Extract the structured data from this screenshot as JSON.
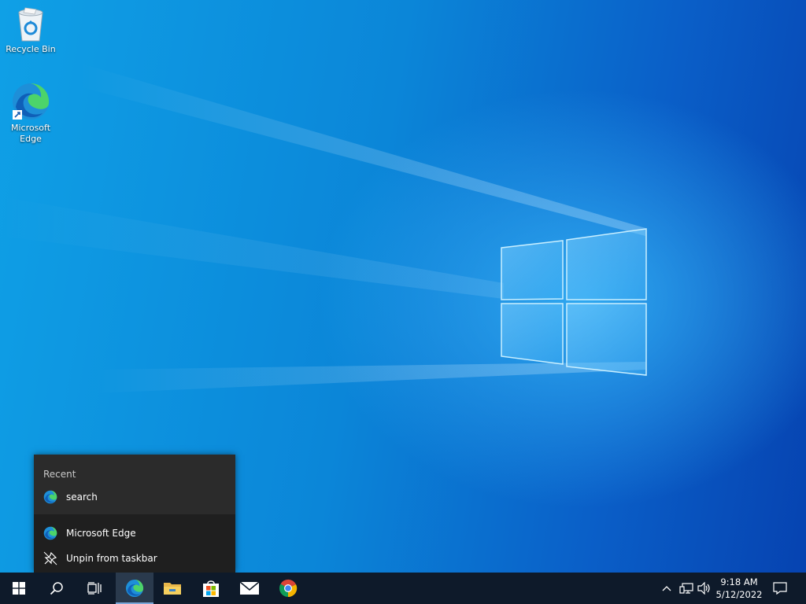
{
  "desktop": {
    "icons": [
      {
        "label": "Recycle Bin",
        "icon": "recycle-bin-icon"
      },
      {
        "label": "Microsoft Edge",
        "icon": "edge-icon"
      }
    ]
  },
  "jumplist": {
    "header": "Recent",
    "recent_items": [
      {
        "label": "search",
        "icon": "edge-icon"
      }
    ],
    "tasks": [
      {
        "label": "Microsoft Edge",
        "icon": "edge-icon"
      },
      {
        "label": "Unpin from taskbar",
        "icon": "unpin-icon"
      }
    ]
  },
  "taskbar": {
    "buttons": [
      {
        "name": "start",
        "icon": "windows-logo-icon"
      },
      {
        "name": "search",
        "icon": "search-icon"
      },
      {
        "name": "task-view",
        "icon": "task-view-icon"
      },
      {
        "name": "edge",
        "icon": "edge-icon",
        "active": true
      },
      {
        "name": "file-explorer",
        "icon": "folder-icon"
      },
      {
        "name": "microsoft-store",
        "icon": "store-icon"
      },
      {
        "name": "mail",
        "icon": "mail-icon"
      },
      {
        "name": "chrome",
        "icon": "chrome-icon"
      }
    ],
    "tray": {
      "time": "9:18 AM",
      "date": "5/12/2022",
      "icons": [
        "chevron-up-icon",
        "network-icon",
        "volume-icon",
        "notification-icon"
      ]
    }
  },
  "colors": {
    "wallpaper_blue": "#0b86d8",
    "taskbar": "#0e1a2a",
    "jumplist_bg": "#2b2b2b",
    "active_indicator": "#7aa7d8"
  }
}
